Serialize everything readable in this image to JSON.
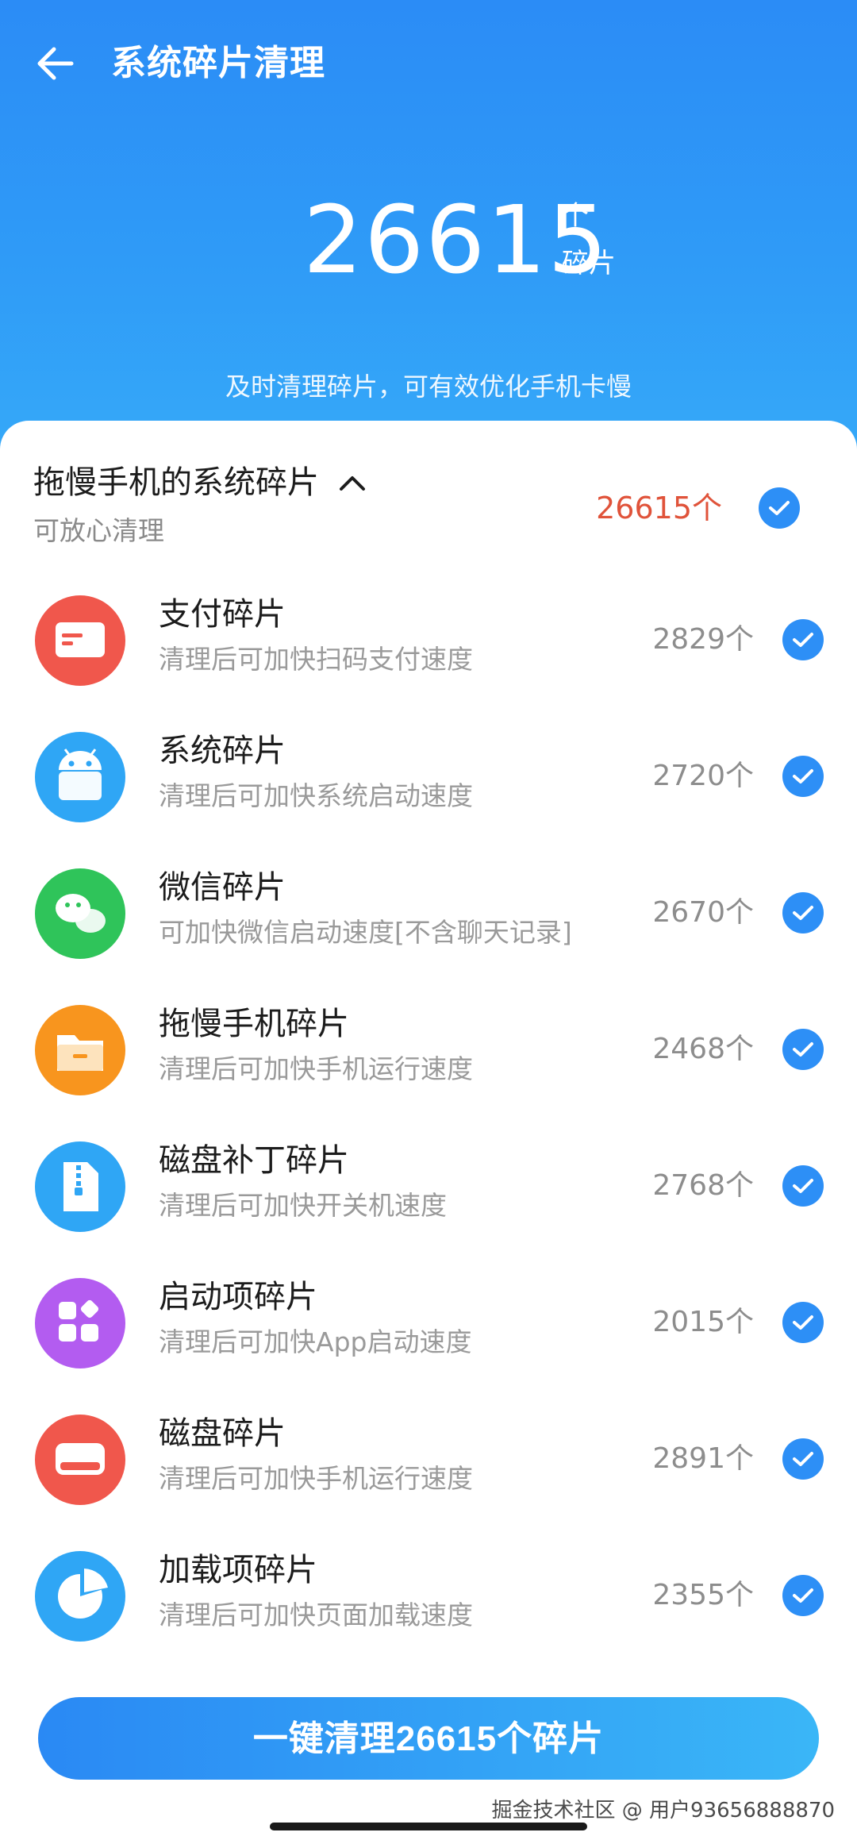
{
  "header": {
    "title": "系统碎片清理"
  },
  "summary": {
    "total": "26615",
    "unit_top": "个",
    "unit_bottom": "碎片",
    "tip": "及时清理碎片，可有效优化手机卡慢"
  },
  "group": {
    "title": "拖慢手机的系统碎片",
    "subtitle": "可放心清理",
    "count": "26615个",
    "checked": true
  },
  "items": [
    {
      "title": "支付碎片",
      "subtitle": "清理后可加快扫码支付速度",
      "count": "2829个",
      "icon": "payment-card-icon",
      "color": "#f0574c",
      "checked": true
    },
    {
      "title": "系统碎片",
      "subtitle": "清理后可加快系统启动速度",
      "count": "2720个",
      "icon": "android-robot-icon",
      "color": "#2fa6f5",
      "checked": true
    },
    {
      "title": "微信碎片",
      "subtitle": "可加快微信启动速度[不含聊天记录]",
      "count": "2670个",
      "icon": "wechat-icon",
      "color": "#2fc45a",
      "checked": true
    },
    {
      "title": "拖慢手机碎片",
      "subtitle": "清理后可加快手机运行速度",
      "count": "2468个",
      "icon": "folder-icon",
      "color": "#f8951e",
      "checked": true
    },
    {
      "title": "磁盘补丁碎片",
      "subtitle": "清理后可加快开关机速度",
      "count": "2768个",
      "icon": "zip-file-icon",
      "color": "#2fa6f5",
      "checked": true
    },
    {
      "title": "启动项碎片",
      "subtitle": "清理后可加快App启动速度",
      "count": "2015个",
      "icon": "apps-grid-icon",
      "color": "#b35cf0",
      "checked": true
    },
    {
      "title": "磁盘碎片",
      "subtitle": "清理后可加快手机运行速度",
      "count": "2891个",
      "icon": "disk-drive-icon",
      "color": "#f0574c",
      "checked": true
    },
    {
      "title": "加载项碎片",
      "subtitle": "清理后可加快页面加载速度",
      "count": "2355个",
      "icon": "pie-chart-icon",
      "color": "#2fa6f5",
      "checked": true
    }
  ],
  "action": {
    "clean_label": "一键清理26615个碎片"
  },
  "watermark": "掘金技术社区 @ 用户93656888870"
}
